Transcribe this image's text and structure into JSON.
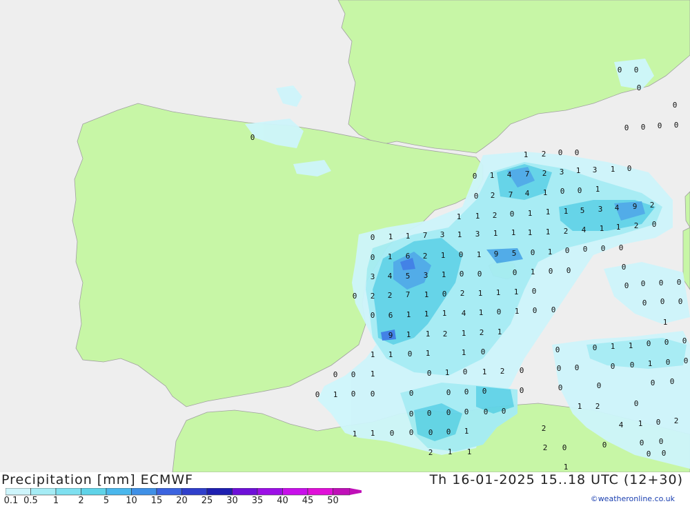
{
  "map": {
    "colors": {
      "sea": "#eeeeee",
      "land": "#c7f6a6",
      "precip_light": "#cef5fb",
      "precip_mid": "#a5ecf5",
      "precip_med": "#5fd3e8",
      "precip_strong": "#4aa9e8",
      "precip_heavy": "#3a7de6"
    },
    "values": [
      "0",
      "0",
      "0",
      "1",
      "2",
      "0",
      "0",
      "0",
      "1",
      "4",
      "7",
      "2",
      "3",
      "1",
      "3",
      "1",
      "0",
      "0",
      "2",
      "7",
      "4",
      "1",
      "0",
      "0",
      "1",
      "0",
      "0",
      "0",
      "0",
      "0",
      "1",
      "1",
      "2",
      "0",
      "1",
      "1",
      "1",
      "5",
      "3",
      "4",
      "9",
      "2",
      "0",
      "1",
      "1",
      "7",
      "3",
      "1",
      "3",
      "1",
      "1",
      "1",
      "1",
      "2",
      "4",
      "1",
      "1",
      "2",
      "0",
      "0",
      "1",
      "6",
      "2",
      "1",
      "0",
      "1",
      "9",
      "5",
      "0",
      "1",
      "0",
      "0",
      "0",
      "0",
      "3",
      "4",
      "5",
      "3",
      "1",
      "0",
      "0",
      "0",
      "1",
      "0",
      "0",
      "0",
      "2",
      "2",
      "7",
      "1",
      "0",
      "2",
      "1",
      "1",
      "1",
      "0",
      "0",
      "0",
      "0",
      "6",
      "1",
      "1",
      "1",
      "4",
      "1",
      "0",
      "1",
      "0",
      "0",
      "0",
      "0",
      "9",
      "1",
      "1",
      "2",
      "1",
      "2",
      "1",
      "0",
      "0",
      "0",
      "0",
      "1",
      "1",
      "0",
      "1",
      "1",
      "0",
      "1",
      "0",
      "0",
      "1",
      "1",
      "0",
      "0",
      "0",
      "0",
      "0",
      "1",
      "0",
      "1",
      "0",
      "1",
      "2",
      "0",
      "0",
      "0",
      "0",
      "0",
      "1",
      "0",
      "0",
      "0",
      "1",
      "0",
      "0",
      "0",
      "0",
      "0",
      "0",
      "0",
      "0",
      "0",
      "0",
      "0",
      "0",
      "0",
      "0",
      "0",
      "0",
      "0",
      "1",
      "2",
      "0",
      "1",
      "1",
      "0",
      "0",
      "0",
      "0",
      "1",
      "2",
      "4",
      "1",
      "0",
      "2",
      "2",
      "1",
      "1",
      "2",
      "0",
      "0",
      "0",
      "0",
      "1",
      "0",
      "0",
      "0"
    ]
  },
  "footer": {
    "title": "Precipitation [mm] ECMWF",
    "datetime": "Th 16-01-2025 15..18 UTC (12+30)",
    "credit": "©weatheronline.co.uk",
    "legend_labels": [
      "0.1",
      "0.5",
      "1",
      "2",
      "5",
      "10",
      "15",
      "20",
      "25",
      "30",
      "35",
      "40",
      "45",
      "50"
    ],
    "legend_colors": [
      "#cef5fb",
      "#a5ecf5",
      "#7ee0f0",
      "#5fd3e8",
      "#4ab7ec",
      "#3f90e6",
      "#3b63df",
      "#2f3fcb",
      "#1e1fb0",
      "#6e10d8",
      "#9c10e6",
      "#c810ea",
      "#e010d8",
      "#c010b8"
    ]
  }
}
